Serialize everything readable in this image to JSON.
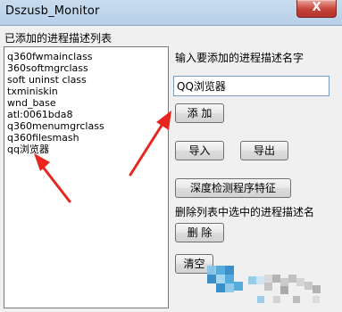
{
  "window": {
    "title": "Dszusb_Monitor",
    "close_glyph": "X"
  },
  "labels": {
    "list": "已添加的进程描述列表",
    "input": "输入要添加的进程描述名字",
    "delete": "删除列表中选中的进程描述名"
  },
  "list": {
    "items": [
      "q360fwmainclass",
      "360softmgrclass",
      "soft uninst class",
      "txminiskin",
      "wnd_base",
      "atl:0061bda8",
      "q360menumgrclass",
      "q360filesmash",
      "qq浏览器"
    ]
  },
  "input": {
    "value": "QQ浏览器"
  },
  "buttons": {
    "add": "添 加",
    "import": "导入",
    "export": "导出",
    "detect": "深度检测程序特征",
    "delete": "删 除",
    "clear": "清空"
  },
  "colors": {
    "annotation_arrow": "#e8261f",
    "titlebar": "#c9dcef",
    "close_button": "#c7433a"
  }
}
